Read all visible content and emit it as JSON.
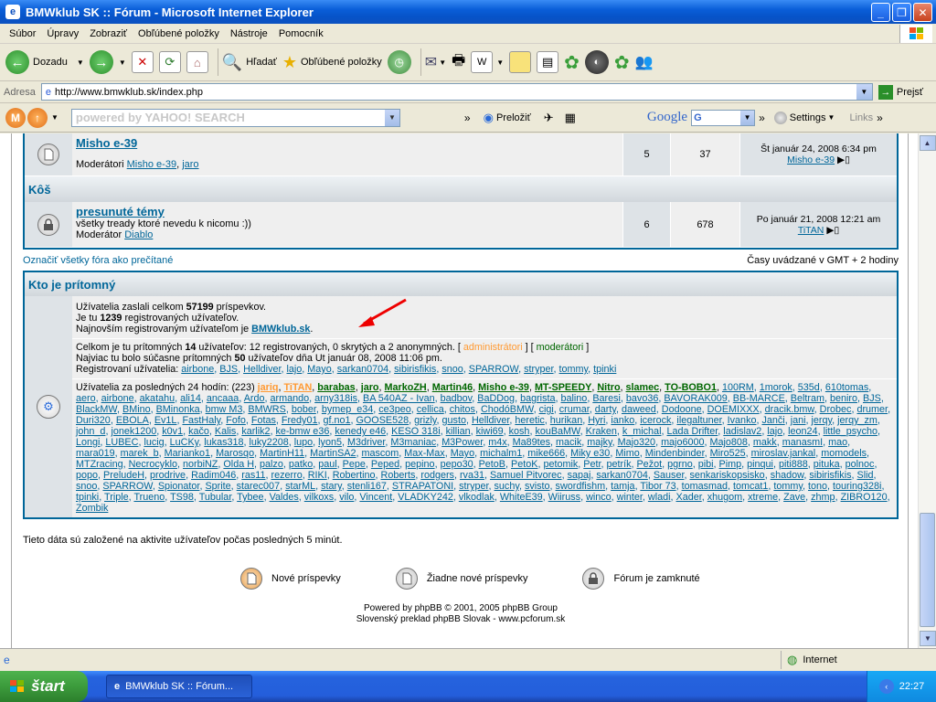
{
  "window": {
    "title": "BMWklub SK :: Fórum - Microsoft Internet Explorer"
  },
  "menu": [
    "Súbor",
    "Úpravy",
    "Zobraziť",
    "Obľúbené položky",
    "Nástroje",
    "Pomocník"
  ],
  "toolbar": {
    "back": "Dozadu",
    "search": "Hľadať",
    "favorites": "Obľúbené položky"
  },
  "address": {
    "label": "Adresa",
    "url": "http://www.bmwklub.sk/index.php",
    "go": "Prejsť"
  },
  "yahoo": {
    "placeholder": "powered by YAHOO! SEARCH",
    "translate": "Preložiť",
    "google": "Google",
    "settings": "Settings",
    "links": "Links"
  },
  "forums": [
    {
      "title": "Misho e-39",
      "desc": "",
      "mods_label": "Moderátori",
      "mods": [
        "Misho e-39",
        "jaro"
      ],
      "topics": "5",
      "posts": "37",
      "last_date": "Št január 24, 2008 6:34 pm",
      "last_user": "Misho e-39"
    },
    {
      "title": "presunuté témy",
      "desc": "všetky tready ktoré nevedu k nicomu :))",
      "mods_label": "Moderátor",
      "mods": [
        "Diablo"
      ],
      "topics": "6",
      "posts": "678",
      "last_date": "Po január 21, 2008 12:21 am",
      "last_user": "TiTAN"
    }
  ],
  "category": "Kôš",
  "mark_read": "Označiť všetky fóra ako prečítané",
  "timezone": "Časy uvádzané v GMT + 2 hodiny",
  "who": {
    "title": "Kto je prítomný",
    "line1_a": "Užívatelia zaslali celkom ",
    "posts": "57199",
    "line1_b": " príspevkov.",
    "line2_a": "Je tu ",
    "users": "1239",
    "line2_b": " registrovaných užívateľov.",
    "line3_a": "Najnovším registrovaným užívateľom je ",
    "newest": "BMWklub.sk",
    "line3_b": ".",
    "online_a": "Celkom je tu prítomných ",
    "online": "14",
    "online_b": " užívateľov: 12 registrovaných, 0 skrytých a 2 anonymných.   [ ",
    "admins": "administrátori",
    "mid": " ]   [ ",
    "mods": "moderátori",
    "end": " ]",
    "max_a": "Najviac tu bolo súčasne prítomných ",
    "max": "50",
    "max_b": " užívateľov dňa Ut január 08, 2008 11:06 pm.",
    "reg_label": "Registrovaní užívatelia: ",
    "reg_users": [
      "airbone",
      "BJS",
      "Helldiver",
      "lajo",
      "Mayo",
      "sarkan0704",
      "sibirisfikis",
      "snoo",
      "SPARROW",
      "stryper",
      "tommy",
      "tpinki"
    ],
    "last24_label": "Užívatelia za posledných 24 hodín: (223) ",
    "last24_special": [
      "jariq",
      "TiTAN",
      "barabas",
      "jaro",
      "MarkoZH",
      "Martin46",
      "Misho e-39",
      "MT-SPEEDY",
      "Nitro",
      "slamec",
      "TO-BOBO1"
    ],
    "last24": "100RM, 1morok, 535d, 610tomas, aero, airbone, akatahu, ali14, ancaaa, Ardo, armando, arny318is, BA 540AZ - Ivan, badbov, BaDDog, bagrista, balino, Baresi, bavo36, BAVORAK009, BB-MARCE, Beltram, beniro, BJS, BlackMW, BMino, BMinonka, bmw M3, BMWRS, bober, bymep_e34, ce3peo, cellica, chitos, ChodóBMW, cigi, crumar, darty, daweed, Dodoone, DOEMIXXX, dracik.bmw, Drobec, drumer, Duri320, EBOLA, Ev1L, FastHaly, Fofo, Fotas, Fredy01, gf.no1, GOOSE528, grizly, gusto, Helldiver, heretic, hurikan, Hyri, ianko, icerock, ilegaltuner, Ivanko, Janči, jani, jerqy, jerqy_zm, john_d, jonek1200, k0v1, kačo, Kalis, karlik2, ke-bmw e36, kenedy e46, KESO 318i, killian, kiwi69, kosh, kouBaMW, Kraken, k_michal, Lada Drifter, ladislav2, lajo, leon24, little_psycho, Longi, LUBEC, lucig, LuCKy, lukas318, luky2208, lupo, lyon5, M3driver, M3maniac, M3Power, m4x, Ma89tes, macik, majky, Majo320, majo6000, Majo808, makk, manasmI, mao, mara019, marek_b, Marianko1, Marosqo, MartinH11, MartinSA2, mascom, Max-Max, Mayo, michalm1, mike666, Miky e30, Mimo, Mindenbinder, Miro525, miroslav.jankal, momodels, MTZracing, Necrocyklo, norbiNZ, Olda H, palzo, patko, paul, Pepe, Peped, pepino, pepo30, PetoB, PetoK, petomik, Petr, petrík, Pežot, pgrno, pibi, Pimp, pinqui, piti888, pituka, polnoc, popo, PreludeH, prodrive, Radim046, ras11, rezerro, RIKI, Robertino, Roberts, rodgers, rva31, Samuel Pitvorec, sapaj, sarkan0704, Sauser, senkariskopsisko, shadow, sibirisfikis, Slid, snoo, SPARROW, Spionator, Sprite, starec007, starML, stary, stenli167, STRAPATONI, stryper, suchy, svisto, swordfishm, tamja, Tibor 73, tomasmad, tomcat1, tommy, tono, touring328i, tpinki, Triple, Trueno, TS98, Tubular, Tybee, Valdes, vilkoxs, vilo, Vincent, VLADKY242, vlkodlak, WhiteE39, Wiiruss, winco, winter, wladi, Xader, xhugom, xtreme, Zave, zhmp, ZIBRO120, Zombik",
    "note": "Tieto dáta sú založené na aktivite užívateľov počas posledných 5 minút."
  },
  "legend": {
    "new": "Nové príspevky",
    "none": "Žiadne nové príspevky",
    "locked": "Fórum je zamknuté"
  },
  "footer": {
    "line1": "Powered by phpBB © 2001, 2005 phpBB Group",
    "line2": "Slovenský preklad phpBB Slovak - www.pcforum.sk"
  },
  "statusbar": {
    "zone": "Internet"
  },
  "taskbar": {
    "start": "štart",
    "item": "BMWklub SK :: Fórum...",
    "clock": "22:27"
  },
  "colors": {
    "link": "#006699",
    "admin": "#ff9a33",
    "mod": "#006600"
  }
}
